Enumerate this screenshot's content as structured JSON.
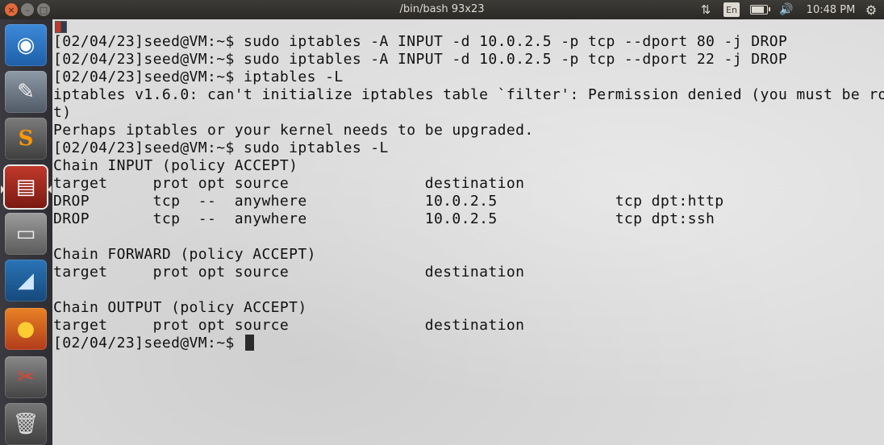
{
  "window": {
    "title": "/bin/bash 93x23",
    "close_glyph": "×",
    "minimize_glyph": "–",
    "maximize_glyph": "□"
  },
  "topbar": {
    "network_icon": "network-arrows-icon",
    "network_glyph": "⇅",
    "keyboard_layout": "En",
    "battery_icon": "battery-icon",
    "volume_icon": "volume-icon",
    "volume_glyph": "🔊",
    "clock": "10:48 PM",
    "settings_icon": "gear-icon",
    "settings_glyph": "⚙"
  },
  "launcher": {
    "items": [
      {
        "name": "dash-icon",
        "glyph": "◉"
      },
      {
        "name": "text-editor-icon",
        "glyph": "✎"
      },
      {
        "name": "sublime-text-icon",
        "glyph": "S"
      },
      {
        "name": "terminal-icon",
        "glyph": "▤"
      },
      {
        "name": "files-icon",
        "glyph": "▭"
      },
      {
        "name": "wireshark-icon",
        "glyph": "◢"
      },
      {
        "name": "firefox-icon",
        "glyph": "●"
      },
      {
        "name": "system-settings-icon",
        "glyph": "✂"
      },
      {
        "name": "trash-icon",
        "glyph": "🗑"
      }
    ]
  },
  "terminal": {
    "output": "[02/04/23]seed@VM:~$ sudo iptables -A INPUT -d 10.0.2.5 -p tcp --dport 80 -j DROP\n[02/04/23]seed@VM:~$ sudo iptables -A INPUT -d 10.0.2.5 -p tcp --dport 22 -j DROP\n[02/04/23]seed@VM:~$ iptables -L\niptables v1.6.0: can't initialize iptables table `filter': Permission denied (you must be roo\nt)\nPerhaps iptables or your kernel needs to be upgraded.\n[02/04/23]seed@VM:~$ sudo iptables -L\nChain INPUT (policy ACCEPT)\ntarget     prot opt source               destination         \nDROP       tcp  --  anywhere             10.0.2.5             tcp dpt:http\nDROP       tcp  --  anywhere             10.0.2.5             tcp dpt:ssh\n\nChain FORWARD (policy ACCEPT)\ntarget     prot opt source               destination         \n\nChain OUTPUT (policy ACCEPT)\ntarget     prot opt source               destination         ",
    "prompt": "[02/04/23]seed@VM:~$ "
  }
}
